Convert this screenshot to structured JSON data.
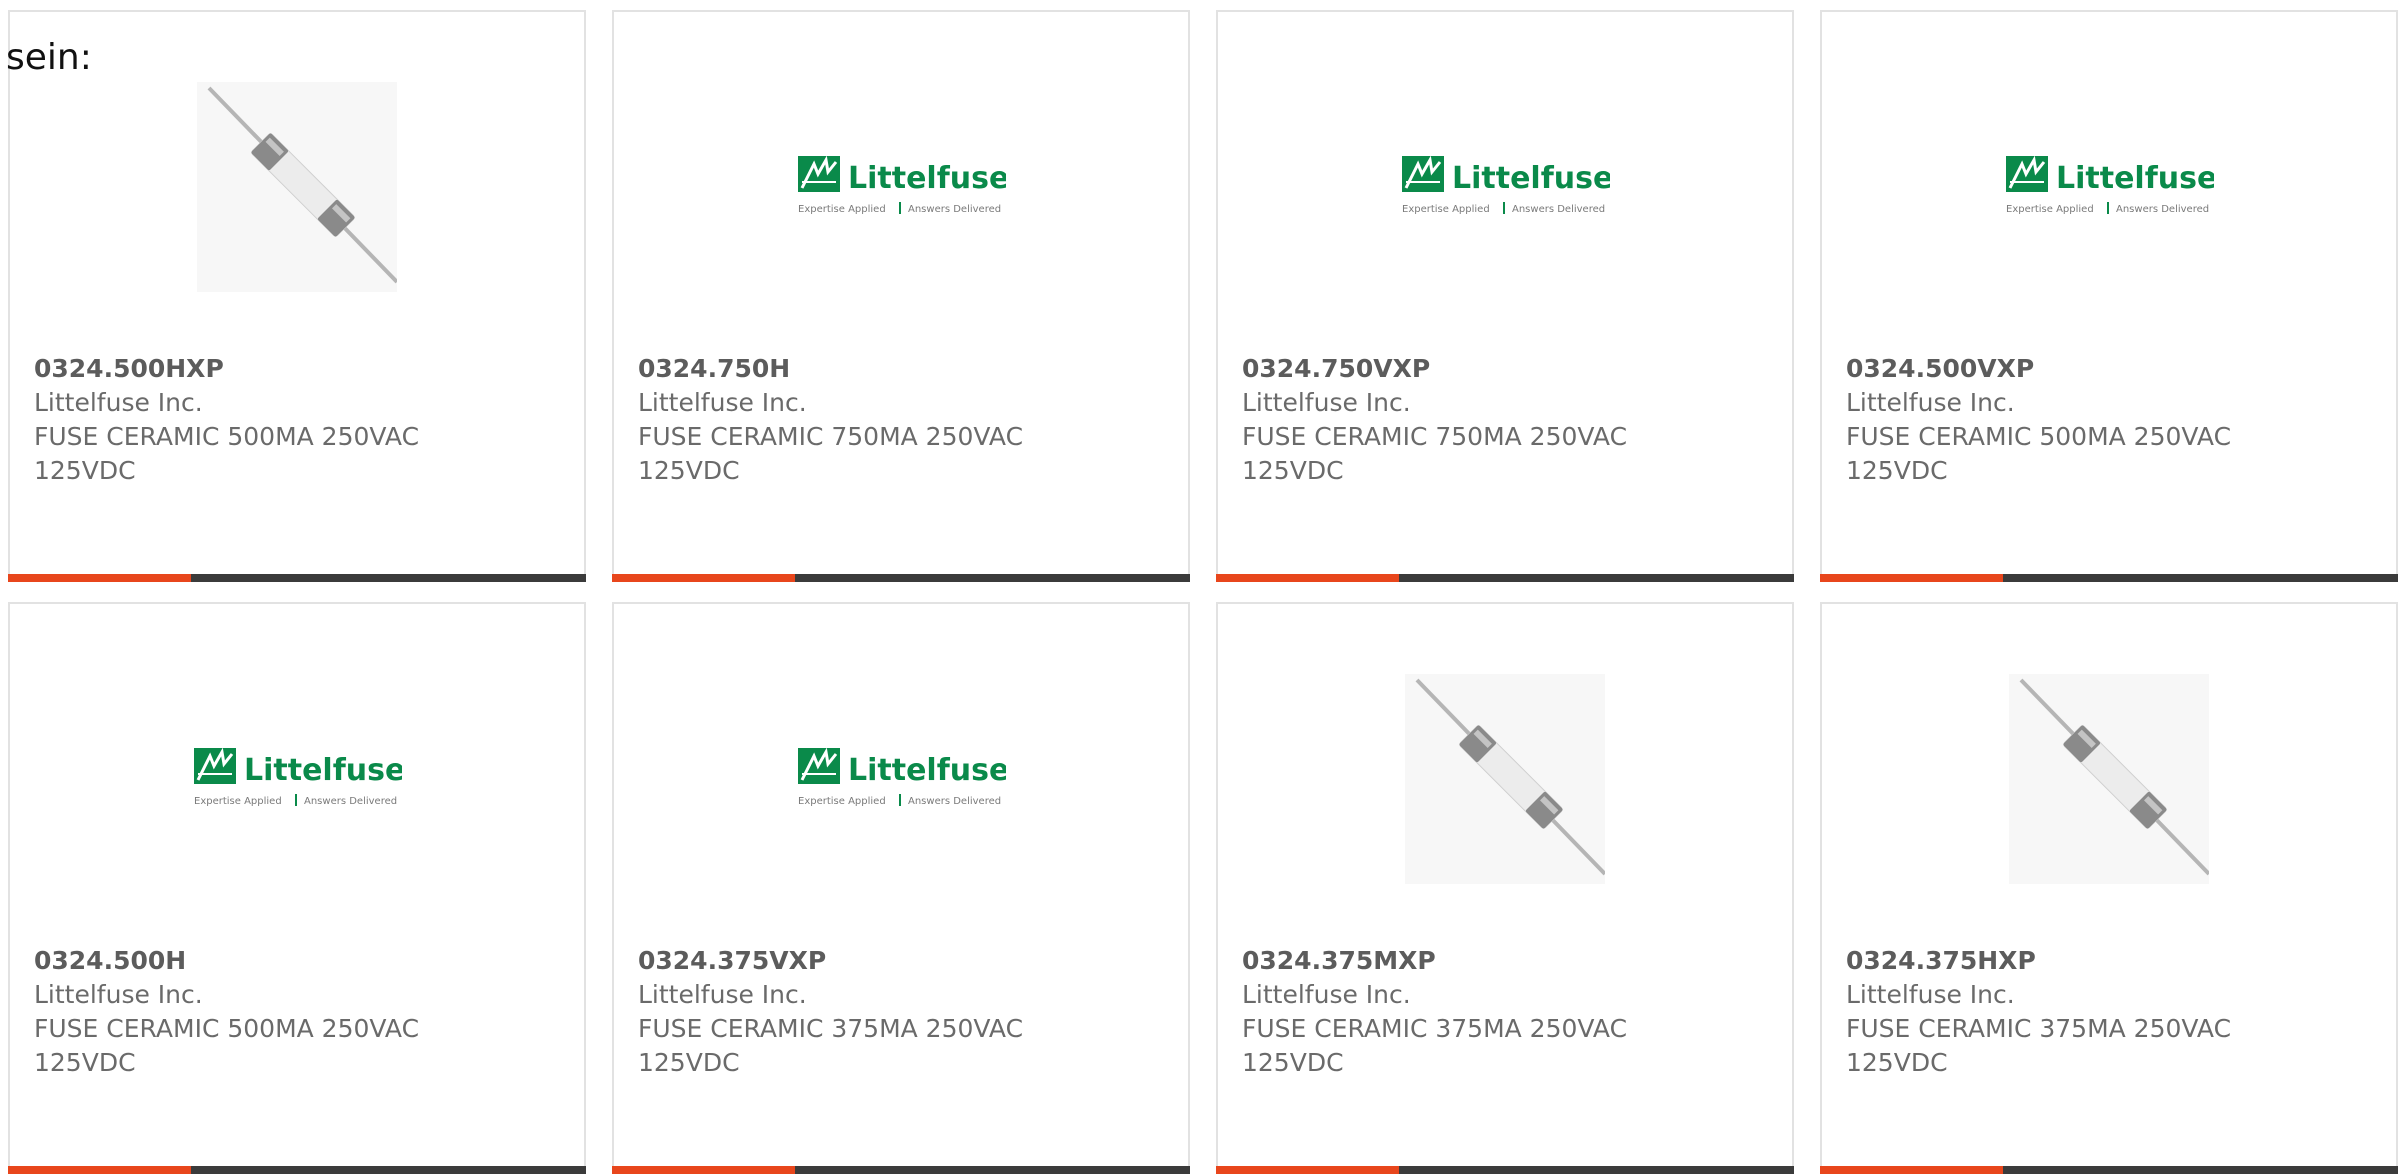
{
  "intro_text": "sein:",
  "colors": {
    "accent_orange": "#e8461c",
    "accent_dark": "#3b3b3b",
    "brand_green": "#0a8a4a"
  },
  "cards": [
    {
      "part_number": "0324.500HXP",
      "manufacturer": "Littelfuse Inc.",
      "desc_line1": "FUSE CERAMIC 500MA 250VAC",
      "desc_line2": "125VDC",
      "image": "fuse-photo"
    },
    {
      "part_number": "0324.750H",
      "manufacturer": "Littelfuse Inc.",
      "desc_line1": "FUSE CERAMIC 750MA 250VAC",
      "desc_line2": "125VDC",
      "image": "littelfuse-logo",
      "logo": {
        "name": "Littelfuse",
        "tagline_left": "Expertise Applied",
        "tagline_right": "Answers Delivered"
      }
    },
    {
      "part_number": "0324.750VXP",
      "manufacturer": "Littelfuse Inc.",
      "desc_line1": "FUSE CERAMIC 750MA 250VAC",
      "desc_line2": "125VDC",
      "image": "littelfuse-logo",
      "logo": {
        "name": "Littelfuse",
        "tagline_left": "Expertise Applied",
        "tagline_right": "Answers Delivered"
      }
    },
    {
      "part_number": "0324.500VXP",
      "manufacturer": "Littelfuse Inc.",
      "desc_line1": "FUSE CERAMIC 500MA 250VAC",
      "desc_line2": "125VDC",
      "image": "littelfuse-logo",
      "logo": {
        "name": "Littelfuse",
        "tagline_left": "Expertise Applied",
        "tagline_right": "Answers Delivered"
      }
    },
    {
      "part_number": "0324.500H",
      "manufacturer": "Littelfuse Inc.",
      "desc_line1": "FUSE CERAMIC 500MA 250VAC",
      "desc_line2": "125VDC",
      "image": "littelfuse-logo",
      "logo": {
        "name": "Littelfuse",
        "tagline_left": "Expertise Applied",
        "tagline_right": "Answers Delivered"
      }
    },
    {
      "part_number": "0324.375VXP",
      "manufacturer": "Littelfuse Inc.",
      "desc_line1": "FUSE CERAMIC 375MA 250VAC",
      "desc_line2": "125VDC",
      "image": "littelfuse-logo",
      "logo": {
        "name": "Littelfuse",
        "tagline_left": "Expertise Applied",
        "tagline_right": "Answers Delivered"
      }
    },
    {
      "part_number": "0324.375MXP",
      "manufacturer": "Littelfuse Inc.",
      "desc_line1": "FUSE CERAMIC 375MA 250VAC",
      "desc_line2": "125VDC",
      "image": "fuse-photo"
    },
    {
      "part_number": "0324.375HXP",
      "manufacturer": "Littelfuse Inc.",
      "desc_line1": "FUSE CERAMIC 375MA 250VAC",
      "desc_line2": "125VDC",
      "image": "fuse-photo"
    }
  ]
}
